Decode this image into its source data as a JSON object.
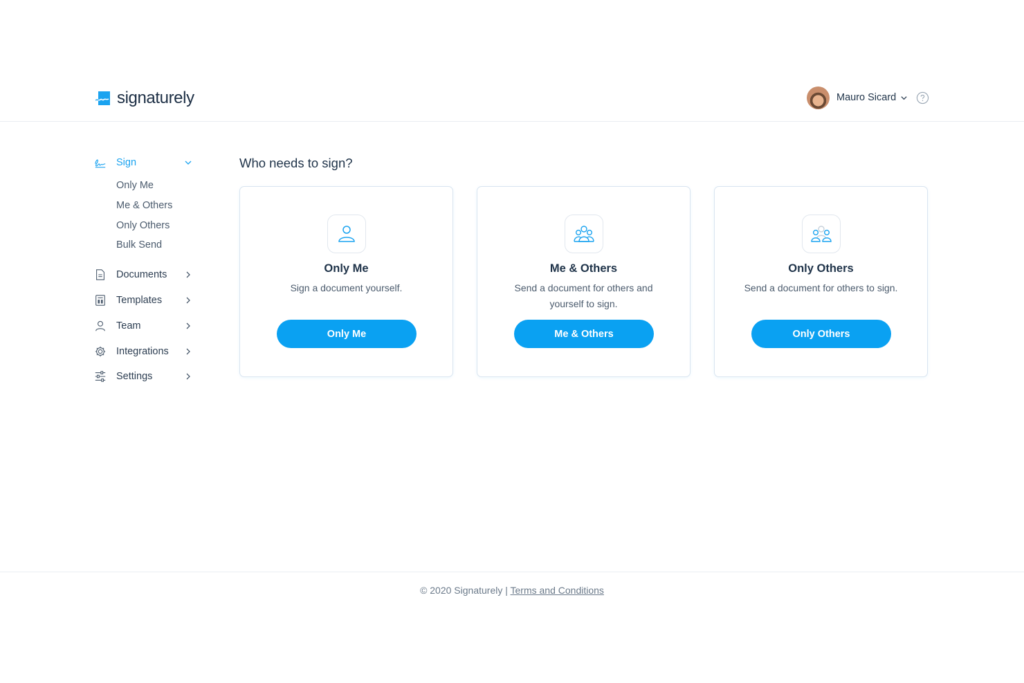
{
  "header": {
    "logo_text": "signaturely",
    "user_name": "Mauro Sicard",
    "icons": [
      "logo-mark-icon",
      "chevron-down-icon",
      "help-icon"
    ]
  },
  "sidebar": {
    "sign_label": "Sign",
    "sign_subitems": [
      "Only Me",
      "Me & Others",
      "Only Others",
      "Bulk Send"
    ],
    "items": [
      {
        "label": "Documents",
        "icon": "document-icon"
      },
      {
        "label": "Templates",
        "icon": "template-icon"
      },
      {
        "label": "Team",
        "icon": "user-icon"
      },
      {
        "label": "Integrations",
        "icon": "gear-icon"
      },
      {
        "label": "Settings",
        "icon": "sliders-icon"
      }
    ]
  },
  "main": {
    "title": "Who needs to sign?",
    "cards": [
      {
        "title": "Only Me",
        "description": "Sign a document yourself.",
        "button": "Only Me",
        "icon": "single-person-icon"
      },
      {
        "title": "Me & Others",
        "description": "Send a document for others and yourself to sign.",
        "button": "Me & Others",
        "icon": "group-icon"
      },
      {
        "title": "Only Others",
        "description": "Send a document for others to sign.",
        "button": "Only Others",
        "icon": "others-icon"
      }
    ]
  },
  "footer": {
    "copyright": "© 2020 Signaturely |",
    "link": "Terms and Conditions"
  },
  "colors": {
    "accent": "#0aa1f2",
    "text": "#1f3349",
    "muted": "#4b5b6d",
    "border": "#d9e4f0"
  }
}
